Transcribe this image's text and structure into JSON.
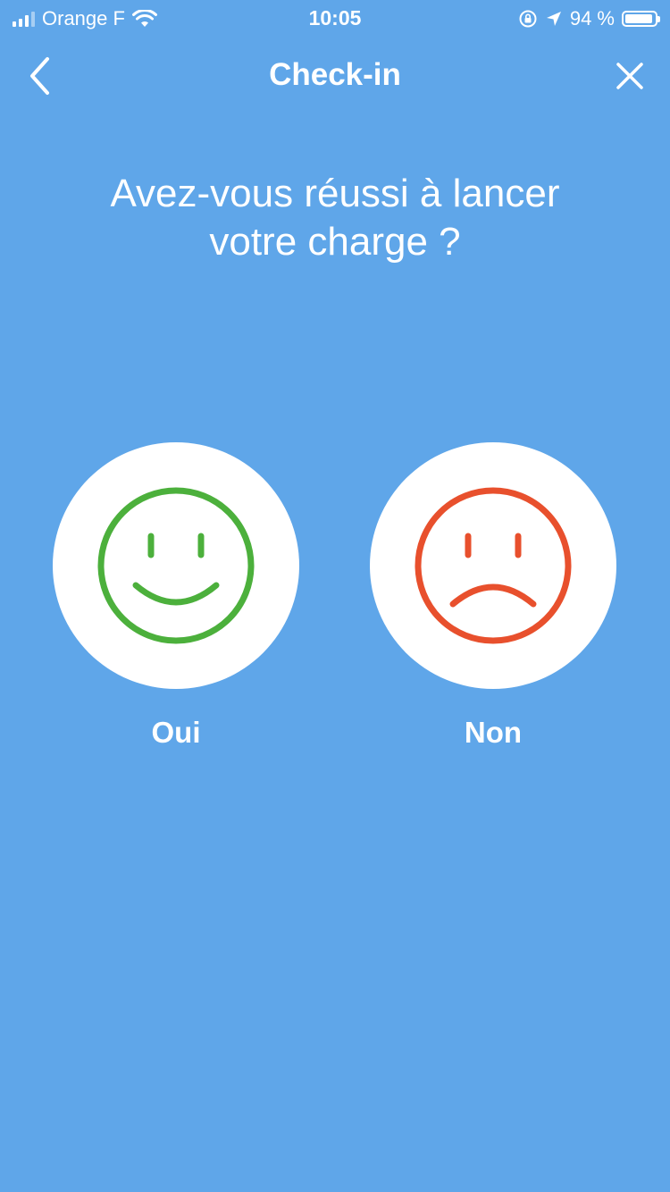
{
  "status_bar": {
    "carrier": "Orange F",
    "time": "10:05",
    "battery_percent": "94 %",
    "battery_level": 0.94
  },
  "nav": {
    "title": "Check-in",
    "back_icon": "chevron-left-icon",
    "close_icon": "close-icon"
  },
  "question": {
    "line1": "Avez-vous réussi à lancer",
    "line2": "votre charge ?"
  },
  "options": [
    {
      "label": "Oui",
      "icon": "happy-face-icon",
      "color": "#4cb03c"
    },
    {
      "label": "Non",
      "icon": "sad-face-icon",
      "color": "#e8502d"
    }
  ],
  "colors": {
    "background": "#5fa6e9",
    "circle": "#ffffff",
    "text": "#ffffff"
  }
}
